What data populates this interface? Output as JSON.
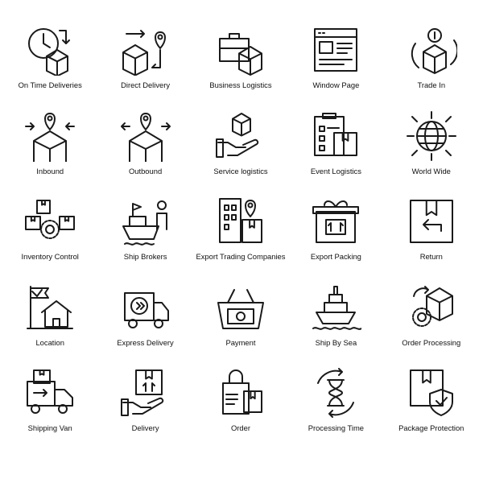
{
  "icons": [
    {
      "label": "On Time Deliveries",
      "icon": "clock-box-icon"
    },
    {
      "label": "Direct Delivery",
      "icon": "box-route-pin-icon"
    },
    {
      "label": "Business Logistics",
      "icon": "briefcase-box-icon"
    },
    {
      "label": "Window Page",
      "icon": "browser-window-icon"
    },
    {
      "label": "Trade In",
      "icon": "dollar-box-cycle-icon"
    },
    {
      "label": "Inbound",
      "icon": "box-inbound-arrows-icon"
    },
    {
      "label": "Outbound",
      "icon": "box-outbound-arrows-icon"
    },
    {
      "label": "Service logistics",
      "icon": "hand-box-icon"
    },
    {
      "label": "Event Logistics",
      "icon": "clipboard-box-icon"
    },
    {
      "label": "World Wide",
      "icon": "globe-arrows-icon"
    },
    {
      "label": "Inventory Control",
      "icon": "boxes-gear-icon"
    },
    {
      "label": "Ship Brokers",
      "icon": "ship-person-icon"
    },
    {
      "label": "Export Trading Companies",
      "icon": "building-pin-box-icon"
    },
    {
      "label": "Export Packing",
      "icon": "gift-box-arrows-icon"
    },
    {
      "label": "Return",
      "icon": "box-return-arrow-icon"
    },
    {
      "label": "Location",
      "icon": "house-flag-icon"
    },
    {
      "label": "Express Delivery",
      "icon": "delivery-truck-icon"
    },
    {
      "label": "Payment",
      "icon": "basket-money-icon"
    },
    {
      "label": "Ship By Sea",
      "icon": "cargo-ship-icon"
    },
    {
      "label": "Order Processing",
      "icon": "box-gear-icon"
    },
    {
      "label": "Shipping Van",
      "icon": "van-box-icon"
    },
    {
      "label": "Delivery",
      "icon": "hand-package-icon"
    },
    {
      "label": "Order",
      "icon": "shopping-bag-box-icon"
    },
    {
      "label": "Processing Time",
      "icon": "hourglass-cycle-icon"
    },
    {
      "label": "Package Protection",
      "icon": "box-shield-icon"
    }
  ]
}
